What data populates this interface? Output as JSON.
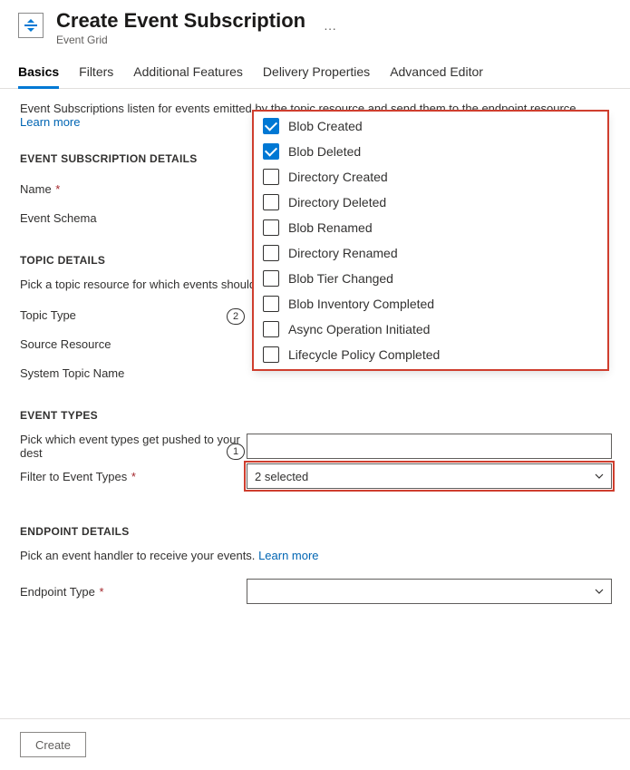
{
  "header": {
    "title": "Create Event Subscription",
    "subtitle": "Event Grid",
    "ellipsis": "···"
  },
  "tabs": [
    {
      "label": "Basics",
      "active": true
    },
    {
      "label": "Filters",
      "active": false
    },
    {
      "label": "Additional Features",
      "active": false
    },
    {
      "label": "Delivery Properties",
      "active": false
    },
    {
      "label": "Advanced Editor",
      "active": false
    }
  ],
  "description": {
    "text": "Event Subscriptions listen for events emitted by the topic resource and send them to the endpoint resource.",
    "learn_more": "Learn more"
  },
  "sections": {
    "sub_details": {
      "heading": "EVENT SUBSCRIPTION DETAILS",
      "name_label": "Name",
      "schema_label": "Event Schema"
    },
    "topic_details": {
      "heading": "TOPIC DETAILS",
      "desc": "Pick a topic resource for which events should b",
      "topic_type_label": "Topic Type",
      "source_resource_label": "Source Resource",
      "system_topic_label": "System Topic Name"
    },
    "event_types": {
      "heading": "EVENT TYPES",
      "desc": "Pick which event types get pushed to your dest",
      "filter_label": "Filter to Event Types",
      "selected_text": "2 selected"
    },
    "endpoint_details": {
      "heading": "ENDPOINT DETAILS",
      "desc": "Pick an event handler to receive your events.",
      "learn_more": "Learn more",
      "endpoint_type_label": "Endpoint Type"
    }
  },
  "event_type_options": [
    {
      "label": "Blob Created",
      "checked": true
    },
    {
      "label": "Blob Deleted",
      "checked": true
    },
    {
      "label": "Directory Created",
      "checked": false
    },
    {
      "label": "Directory Deleted",
      "checked": false
    },
    {
      "label": "Blob Renamed",
      "checked": false
    },
    {
      "label": "Directory Renamed",
      "checked": false
    },
    {
      "label": "Blob Tier Changed",
      "checked": false
    },
    {
      "label": "Blob Inventory Completed",
      "checked": false
    },
    {
      "label": "Async Operation Initiated",
      "checked": false
    },
    {
      "label": "Lifecycle Policy Completed",
      "checked": false
    }
  ],
  "callouts": {
    "pill1": "1",
    "pill2": "2"
  },
  "footer": {
    "create_label": "Create"
  }
}
